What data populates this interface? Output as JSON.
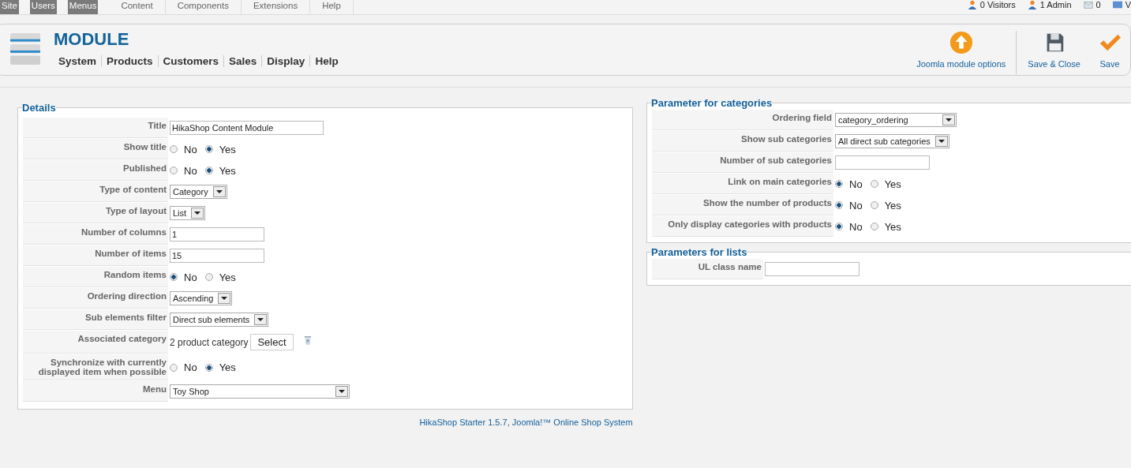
{
  "top_menu": [
    {
      "label": "Site",
      "disabled": true
    },
    {
      "label": "Users",
      "disabled": true
    },
    {
      "label": "Menus",
      "disabled": true
    },
    {
      "label": "Content",
      "disabled": false
    },
    {
      "label": "Components",
      "disabled": false
    },
    {
      "label": "Extensions",
      "disabled": false
    },
    {
      "label": "Help",
      "disabled": false
    }
  ],
  "status": [
    {
      "kind": "visitors",
      "label": "0 Visitors"
    },
    {
      "kind": "admin",
      "label": "1 Admin"
    },
    {
      "kind": "messages",
      "label": "0"
    },
    {
      "kind": "view",
      "label": "V"
    }
  ],
  "header": {
    "title": "MODULE",
    "nav": [
      "System",
      "Products",
      "Customers",
      "Sales",
      "Display",
      "Help"
    ],
    "toolbar": [
      {
        "kind": "options",
        "label": "Joomla module options"
      },
      {
        "kind": "save_close",
        "label": "Save & Close"
      },
      {
        "kind": "save",
        "label": "Save"
      }
    ]
  },
  "details": {
    "legend": "Details",
    "rows": [
      {
        "label": "Title",
        "kind": "text",
        "value": "HikaShop Content Module"
      },
      {
        "label": "Show title",
        "kind": "radio",
        "options": [
          {
            "label": "No",
            "selected": false
          },
          {
            "label": "Yes",
            "selected": true
          }
        ]
      },
      {
        "label": "Published",
        "kind": "radio",
        "options": [
          {
            "label": "No",
            "selected": false
          },
          {
            "label": "Yes",
            "selected": true
          }
        ]
      },
      {
        "label": "Type of content",
        "kind": "select",
        "value": "Category"
      },
      {
        "label": "Type of layout",
        "kind": "select",
        "value": "List"
      },
      {
        "label": "Number of columns",
        "kind": "text",
        "value": "1"
      },
      {
        "label": "Number of items",
        "kind": "text",
        "value": "15"
      },
      {
        "label": "Random items",
        "kind": "radio",
        "options": [
          {
            "label": "No",
            "selected": true
          },
          {
            "label": "Yes",
            "selected": false
          }
        ]
      },
      {
        "label": "Ordering direction",
        "kind": "select",
        "value": "Ascending"
      },
      {
        "label": "Sub elements filter",
        "kind": "select",
        "value": "Direct sub elements"
      },
      {
        "label": "Associated category",
        "kind": "category",
        "value": "2 product category",
        "button": "Select"
      },
      {
        "label": "Synchronize with currently displayed item when possible",
        "kind": "radio",
        "options": [
          {
            "label": "No",
            "selected": false
          },
          {
            "label": "Yes",
            "selected": true
          }
        ]
      },
      {
        "label": "Menu",
        "kind": "select",
        "value": "Toy Shop"
      }
    ]
  },
  "categories": {
    "legend": "Parameter for categories",
    "rows": [
      {
        "label": "Ordering field",
        "kind": "select",
        "value": "category_ordering"
      },
      {
        "label": "Show sub categories",
        "kind": "select",
        "value": "All direct sub categories"
      },
      {
        "label": "Number of sub categories",
        "kind": "text"
      },
      {
        "label": "Link on main categories",
        "kind": "radio",
        "options": [
          {
            "label": "No",
            "selected": true
          },
          {
            "label": "Yes",
            "selected": false
          }
        ]
      },
      {
        "label": "Show the number of products",
        "kind": "radio",
        "options": [
          {
            "label": "No",
            "selected": true
          },
          {
            "label": "Yes",
            "selected": false
          }
        ]
      },
      {
        "label": "Only display categories with products",
        "kind": "radio",
        "options": [
          {
            "label": "No",
            "selected": true
          },
          {
            "label": "Yes",
            "selected": false
          }
        ]
      }
    ]
  },
  "lists": {
    "legend": "Parameters for lists",
    "rows": [
      {
        "label": "UL class name",
        "kind": "text"
      }
    ]
  },
  "footer": "HikaShop Starter 1.5.7, Joomla!™ Online Shop System"
}
